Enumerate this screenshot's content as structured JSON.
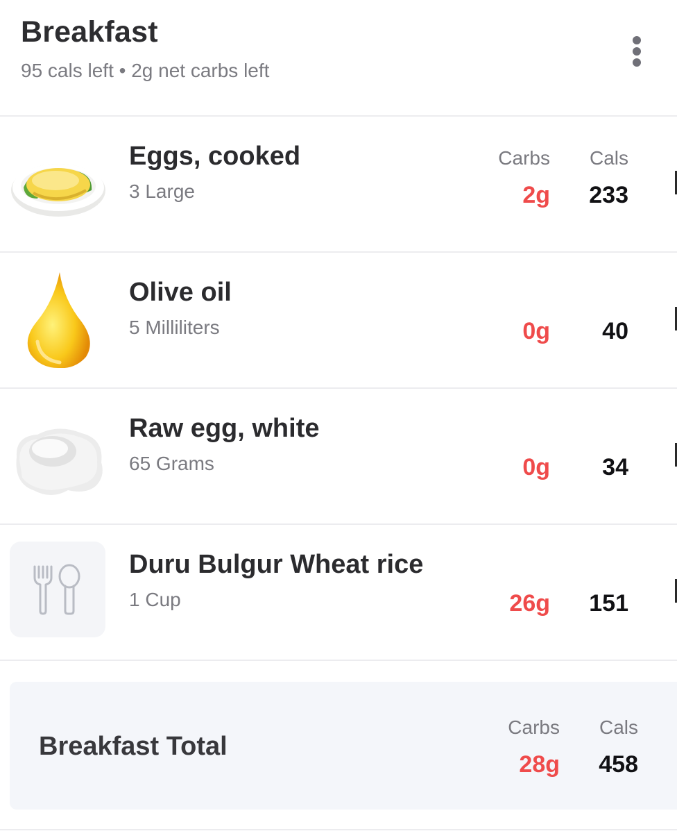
{
  "meal": {
    "title": "Breakfast",
    "subtitle": "95 cals left • 2g net carbs left"
  },
  "columns": {
    "carbs": "Carbs",
    "cals": "Cals"
  },
  "items": [
    {
      "name": "Eggs, cooked",
      "quantity": "3 Large",
      "carbs": "2g",
      "cals": "233",
      "image": "fried-egg-icon"
    },
    {
      "name": "Olive oil",
      "quantity": "5 Milliliters",
      "carbs": "0g",
      "cals": "40",
      "image": "oil-drop-icon"
    },
    {
      "name": "Raw egg, white",
      "quantity": "65 Grams",
      "carbs": "0g",
      "cals": "34",
      "image": "egg-white-icon"
    },
    {
      "name": "Duru Bulgur Wheat rice",
      "quantity": "1 Cup",
      "carbs": "26g",
      "cals": "151",
      "image": "fork-spoon-icon"
    }
  ],
  "total": {
    "label": "Breakfast Total",
    "carbs": "28g",
    "cals": "458"
  },
  "colors": {
    "carbs": "#ef4b4b",
    "total_bg": "#f4f6fa",
    "divider": "#ececef"
  }
}
